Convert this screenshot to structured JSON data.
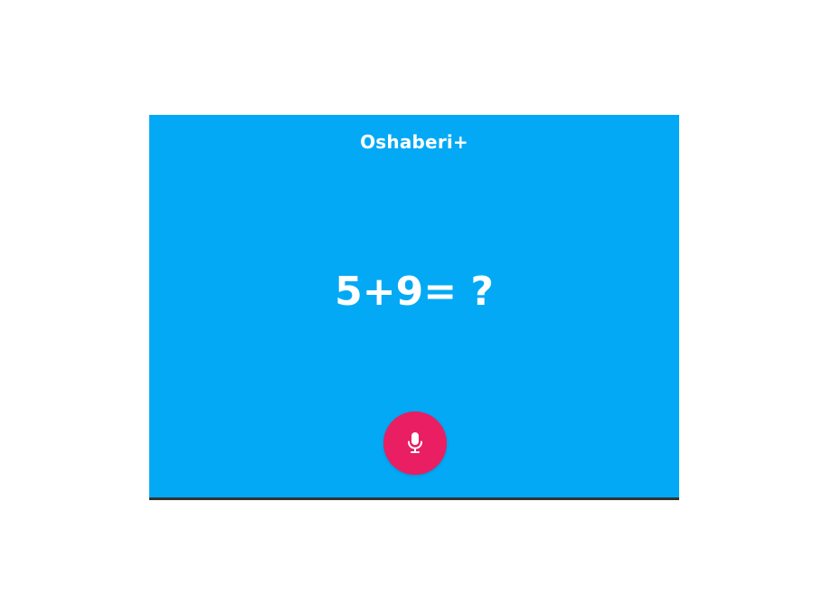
{
  "app": {
    "title": "Oshaberi+",
    "background_color": "#03a9f4",
    "border_color": "#333333"
  },
  "quiz": {
    "question": "5+9= ?"
  },
  "mic_button": {
    "icon": "microphone-icon",
    "color": "#e91e63"
  }
}
